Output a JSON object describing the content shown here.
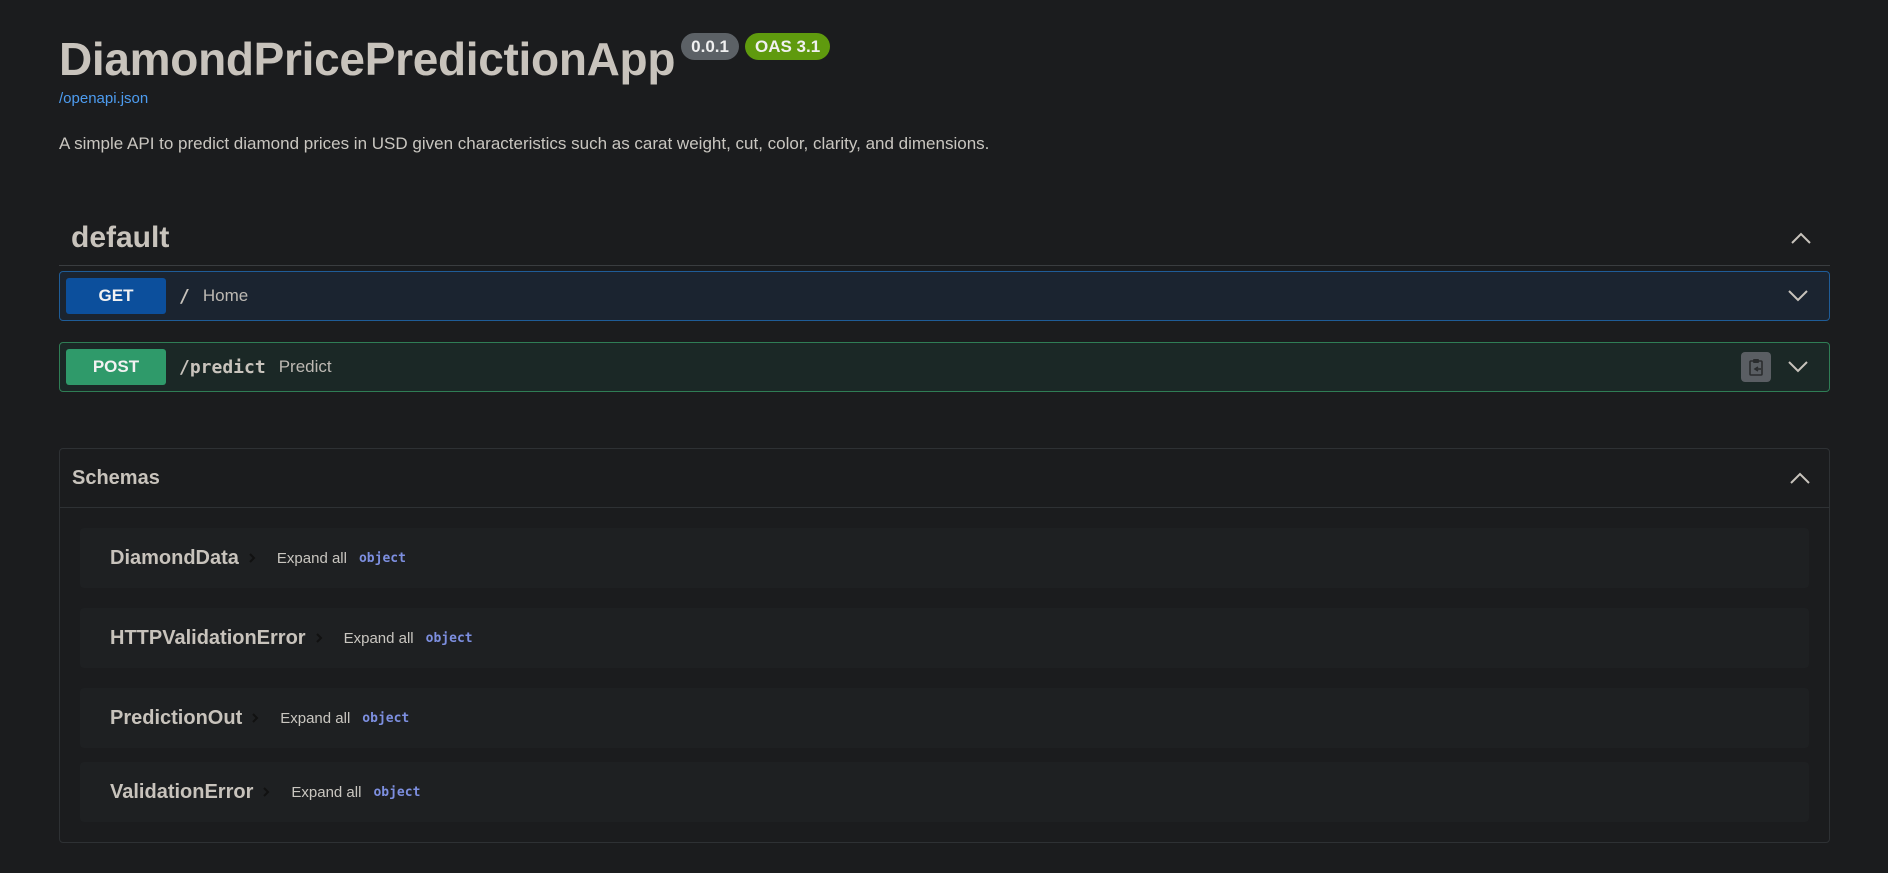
{
  "info": {
    "title": "DiamondPricePredictionApp",
    "version": "0.0.1",
    "oas": "OAS 3.1",
    "spec_link": "/openapi.json",
    "description": "A simple API to predict diamond prices in USD given characteristics such as carat weight, cut, color, clarity, and dimensions."
  },
  "tag": {
    "name": "default"
  },
  "operations": [
    {
      "method": "GET",
      "path": "/",
      "summary": "Home"
    },
    {
      "method": "POST",
      "path": "/predict",
      "summary": "Predict"
    }
  ],
  "schemas": {
    "title": "Schemas",
    "items": [
      {
        "name": "DiamondData",
        "expand": "Expand all",
        "type": "object"
      },
      {
        "name": "HTTPValidationError",
        "expand": "Expand all",
        "type": "object"
      },
      {
        "name": "PredictionOut",
        "expand": "Expand all",
        "type": "object"
      },
      {
        "name": "ValidationError",
        "expand": "Expand all",
        "type": "object"
      }
    ]
  },
  "colors": {
    "background": "#1b1c1e",
    "get": "#0c4f9c",
    "post": "#2f9a6a",
    "link": "#4d9cf0",
    "oas_badge": "#5f9a0e",
    "version_badge": "#5c6166"
  }
}
